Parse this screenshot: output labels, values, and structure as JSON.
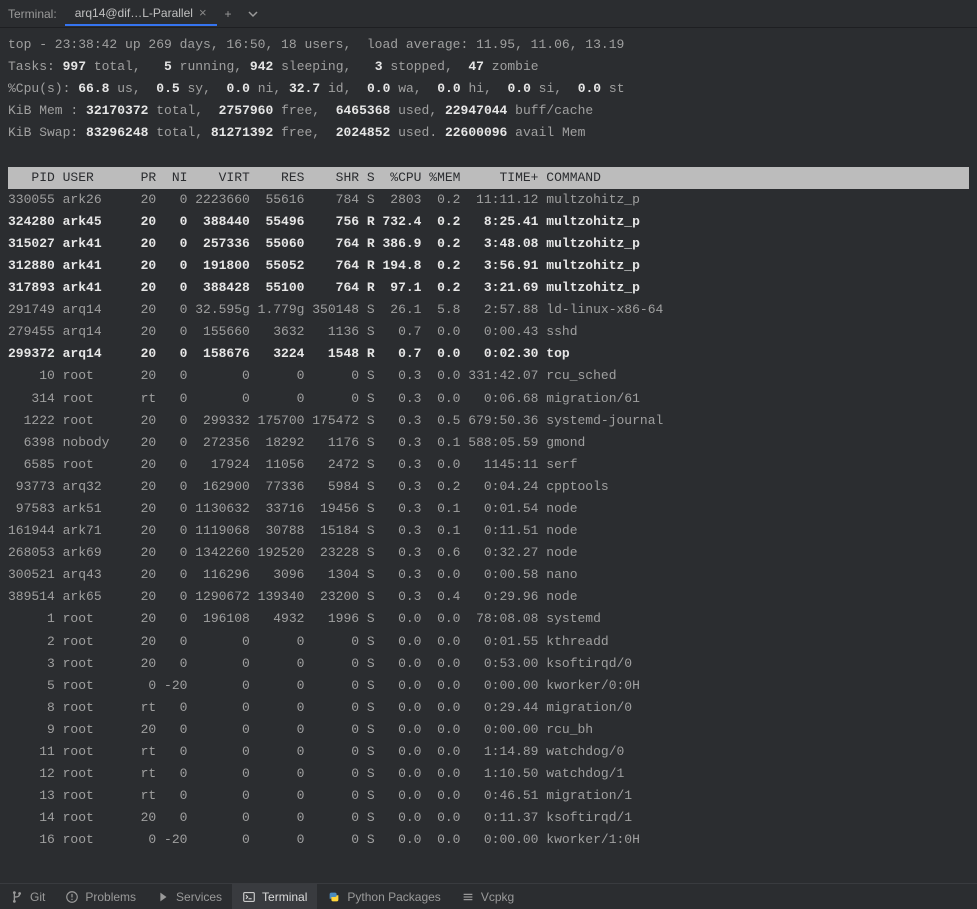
{
  "tabBar": {
    "label": "Terminal:",
    "activeTab": "arq14@dif…L-Parallel"
  },
  "top": {
    "line1_pre": "top - 23:38:42 up 269 days, 16:50, 18 users,  load average: 11.95, 11.06, 13.19",
    "tasks": {
      "label": "Tasks:",
      "total": "997",
      "totalLbl": " total,",
      "running": "5",
      "runningLbl": " running,",
      "sleeping": "942",
      "sleepingLbl": " sleeping,",
      "stopped": "3",
      "stoppedLbl": " stopped,",
      "zombie": "47",
      "zombieLbl": " zombie"
    },
    "cpu": {
      "label": "%Cpu(s):",
      "us": "66.8",
      "usL": " us,",
      "sy": "0.5",
      "syL": " sy,",
      "ni": "0.0",
      "niL": " ni,",
      "id": "32.7",
      "idL": " id,",
      "wa": "0.0",
      "waL": " wa,",
      "hi": "0.0",
      "hiL": " hi,",
      "si": "0.0",
      "siL": " si,",
      "st": "0.0",
      "stL": " st"
    },
    "mem": {
      "label": "KiB Mem :",
      "total": "32170372",
      "totalL": " total,",
      "free": "2757960",
      "freeL": " free,",
      "used": "6465368",
      "usedL": " used,",
      "buff": "22947044",
      "buffL": " buff/cache"
    },
    "swap": {
      "label": "KiB Swap:",
      "total": "83296248",
      "totalL": " total,",
      "free": "81271392",
      "freeL": " free,",
      "used": "2024852",
      "usedL": " used.",
      "avail": "22600096",
      "availL": " avail Mem"
    }
  },
  "cols": "   PID USER      PR  NI    VIRT    RES    SHR S  %CPU %MEM     TIME+ COMMAND                                                                            ",
  "rows": [
    {
      "bold": false,
      "pid": "330055",
      "user": "ark26",
      "pr": "20",
      "ni": "0",
      "virt": "2223660",
      "res": "55616",
      "shr": "784",
      "s": "S",
      "cpu": "2803",
      "mem": "0.2",
      "time": "11:11.12",
      "cmd": "multzohitz_p"
    },
    {
      "bold": true,
      "pid": "324280",
      "user": "ark45",
      "pr": "20",
      "ni": "0",
      "virt": "388440",
      "res": "55496",
      "shr": "756",
      "s": "R",
      "cpu": "732.4",
      "mem": "0.2",
      "time": "8:25.41",
      "cmd": "multzohitz_p"
    },
    {
      "bold": true,
      "pid": "315027",
      "user": "ark41",
      "pr": "20",
      "ni": "0",
      "virt": "257336",
      "res": "55060",
      "shr": "764",
      "s": "R",
      "cpu": "386.9",
      "mem": "0.2",
      "time": "3:48.08",
      "cmd": "multzohitz_p"
    },
    {
      "bold": true,
      "pid": "312880",
      "user": "ark41",
      "pr": "20",
      "ni": "0",
      "virt": "191800",
      "res": "55052",
      "shr": "764",
      "s": "R",
      "cpu": "194.8",
      "mem": "0.2",
      "time": "3:56.91",
      "cmd": "multzohitz_p"
    },
    {
      "bold": true,
      "pid": "317893",
      "user": "ark41",
      "pr": "20",
      "ni": "0",
      "virt": "388428",
      "res": "55100",
      "shr": "764",
      "s": "R",
      "cpu": "97.1",
      "mem": "0.2",
      "time": "3:21.69",
      "cmd": "multzohitz_p"
    },
    {
      "bold": false,
      "pid": "291749",
      "user": "arq14",
      "pr": "20",
      "ni": "0",
      "virt": "32.595g",
      "res": "1.779g",
      "shr": "350148",
      "s": "S",
      "cpu": "26.1",
      "mem": "5.8",
      "time": "2:57.88",
      "cmd": "ld-linux-x86-64"
    },
    {
      "bold": false,
      "pid": "279455",
      "user": "arq14",
      "pr": "20",
      "ni": "0",
      "virt": "155660",
      "res": "3632",
      "shr": "1136",
      "s": "S",
      "cpu": "0.7",
      "mem": "0.0",
      "time": "0:00.43",
      "cmd": "sshd"
    },
    {
      "bold": true,
      "pid": "299372",
      "user": "arq14",
      "pr": "20",
      "ni": "0",
      "virt": "158676",
      "res": "3224",
      "shr": "1548",
      "s": "R",
      "cpu": "0.7",
      "mem": "0.0",
      "time": "0:02.30",
      "cmd": "top"
    },
    {
      "bold": false,
      "pid": "10",
      "user": "root",
      "pr": "20",
      "ni": "0",
      "virt": "0",
      "res": "0",
      "shr": "0",
      "s": "S",
      "cpu": "0.3",
      "mem": "0.0",
      "time": "331:42.07",
      "cmd": "rcu_sched"
    },
    {
      "bold": false,
      "pid": "314",
      "user": "root",
      "pr": "rt",
      "ni": "0",
      "virt": "0",
      "res": "0",
      "shr": "0",
      "s": "S",
      "cpu": "0.3",
      "mem": "0.0",
      "time": "0:06.68",
      "cmd": "migration/61"
    },
    {
      "bold": false,
      "pid": "1222",
      "user": "root",
      "pr": "20",
      "ni": "0",
      "virt": "299332",
      "res": "175700",
      "shr": "175472",
      "s": "S",
      "cpu": "0.3",
      "mem": "0.5",
      "time": "679:50.36",
      "cmd": "systemd-journal"
    },
    {
      "bold": false,
      "pid": "6398",
      "user": "nobody",
      "pr": "20",
      "ni": "0",
      "virt": "272356",
      "res": "18292",
      "shr": "1176",
      "s": "S",
      "cpu": "0.3",
      "mem": "0.1",
      "time": "588:05.59",
      "cmd": "gmond"
    },
    {
      "bold": false,
      "pid": "6585",
      "user": "root",
      "pr": "20",
      "ni": "0",
      "virt": "17924",
      "res": "11056",
      "shr": "2472",
      "s": "S",
      "cpu": "0.3",
      "mem": "0.0",
      "time": "1145:11",
      "cmd": "serf"
    },
    {
      "bold": false,
      "pid": "93773",
      "user": "arq32",
      "pr": "20",
      "ni": "0",
      "virt": "162900",
      "res": "77336",
      "shr": "5984",
      "s": "S",
      "cpu": "0.3",
      "mem": "0.2",
      "time": "0:04.24",
      "cmd": "cpptools"
    },
    {
      "bold": false,
      "pid": "97583",
      "user": "ark51",
      "pr": "20",
      "ni": "0",
      "virt": "1130632",
      "res": "33716",
      "shr": "19456",
      "s": "S",
      "cpu": "0.3",
      "mem": "0.1",
      "time": "0:01.54",
      "cmd": "node"
    },
    {
      "bold": false,
      "pid": "161944",
      "user": "ark71",
      "pr": "20",
      "ni": "0",
      "virt": "1119068",
      "res": "30788",
      "shr": "15184",
      "s": "S",
      "cpu": "0.3",
      "mem": "0.1",
      "time": "0:11.51",
      "cmd": "node"
    },
    {
      "bold": false,
      "pid": "268053",
      "user": "ark69",
      "pr": "20",
      "ni": "0",
      "virt": "1342260",
      "res": "192520",
      "shr": "23228",
      "s": "S",
      "cpu": "0.3",
      "mem": "0.6",
      "time": "0:32.27",
      "cmd": "node"
    },
    {
      "bold": false,
      "pid": "300521",
      "user": "arq43",
      "pr": "20",
      "ni": "0",
      "virt": "116296",
      "res": "3096",
      "shr": "1304",
      "s": "S",
      "cpu": "0.3",
      "mem": "0.0",
      "time": "0:00.58",
      "cmd": "nano"
    },
    {
      "bold": false,
      "pid": "389514",
      "user": "ark65",
      "pr": "20",
      "ni": "0",
      "virt": "1290672",
      "res": "139340",
      "shr": "23200",
      "s": "S",
      "cpu": "0.3",
      "mem": "0.4",
      "time": "0:29.96",
      "cmd": "node"
    },
    {
      "bold": false,
      "pid": "1",
      "user": "root",
      "pr": "20",
      "ni": "0",
      "virt": "196108",
      "res": "4932",
      "shr": "1996",
      "s": "S",
      "cpu": "0.0",
      "mem": "0.0",
      "time": "78:08.08",
      "cmd": "systemd"
    },
    {
      "bold": false,
      "pid": "2",
      "user": "root",
      "pr": "20",
      "ni": "0",
      "virt": "0",
      "res": "0",
      "shr": "0",
      "s": "S",
      "cpu": "0.0",
      "mem": "0.0",
      "time": "0:01.55",
      "cmd": "kthreadd"
    },
    {
      "bold": false,
      "pid": "3",
      "user": "root",
      "pr": "20",
      "ni": "0",
      "virt": "0",
      "res": "0",
      "shr": "0",
      "s": "S",
      "cpu": "0.0",
      "mem": "0.0",
      "time": "0:53.00",
      "cmd": "ksoftirqd/0"
    },
    {
      "bold": false,
      "pid": "5",
      "user": "root",
      "pr": "0",
      "ni": "-20",
      "virt": "0",
      "res": "0",
      "shr": "0",
      "s": "S",
      "cpu": "0.0",
      "mem": "0.0",
      "time": "0:00.00",
      "cmd": "kworker/0:0H"
    },
    {
      "bold": false,
      "pid": "8",
      "user": "root",
      "pr": "rt",
      "ni": "0",
      "virt": "0",
      "res": "0",
      "shr": "0",
      "s": "S",
      "cpu": "0.0",
      "mem": "0.0",
      "time": "0:29.44",
      "cmd": "migration/0"
    },
    {
      "bold": false,
      "pid": "9",
      "user": "root",
      "pr": "20",
      "ni": "0",
      "virt": "0",
      "res": "0",
      "shr": "0",
      "s": "S",
      "cpu": "0.0",
      "mem": "0.0",
      "time": "0:00.00",
      "cmd": "rcu_bh"
    },
    {
      "bold": false,
      "pid": "11",
      "user": "root",
      "pr": "rt",
      "ni": "0",
      "virt": "0",
      "res": "0",
      "shr": "0",
      "s": "S",
      "cpu": "0.0",
      "mem": "0.0",
      "time": "1:14.89",
      "cmd": "watchdog/0"
    },
    {
      "bold": false,
      "pid": "12",
      "user": "root",
      "pr": "rt",
      "ni": "0",
      "virt": "0",
      "res": "0",
      "shr": "0",
      "s": "S",
      "cpu": "0.0",
      "mem": "0.0",
      "time": "1:10.50",
      "cmd": "watchdog/1"
    },
    {
      "bold": false,
      "pid": "13",
      "user": "root",
      "pr": "rt",
      "ni": "0",
      "virt": "0",
      "res": "0",
      "shr": "0",
      "s": "S",
      "cpu": "0.0",
      "mem": "0.0",
      "time": "0:46.51",
      "cmd": "migration/1"
    },
    {
      "bold": false,
      "pid": "14",
      "user": "root",
      "pr": "20",
      "ni": "0",
      "virt": "0",
      "res": "0",
      "shr": "0",
      "s": "S",
      "cpu": "0.0",
      "mem": "0.0",
      "time": "0:11.37",
      "cmd": "ksoftirqd/1"
    },
    {
      "bold": false,
      "pid": "16",
      "user": "root",
      "pr": "0",
      "ni": "-20",
      "virt": "0",
      "res": "0",
      "shr": "0",
      "s": "S",
      "cpu": "0.0",
      "mem": "0.0",
      "time": "0:00.00",
      "cmd": "kworker/1:0H"
    }
  ],
  "bottom": {
    "git": "Git",
    "problems": "Problems",
    "services": "Services",
    "terminal": "Terminal",
    "python": "Python Packages",
    "vcpkg": "Vcpkg"
  }
}
